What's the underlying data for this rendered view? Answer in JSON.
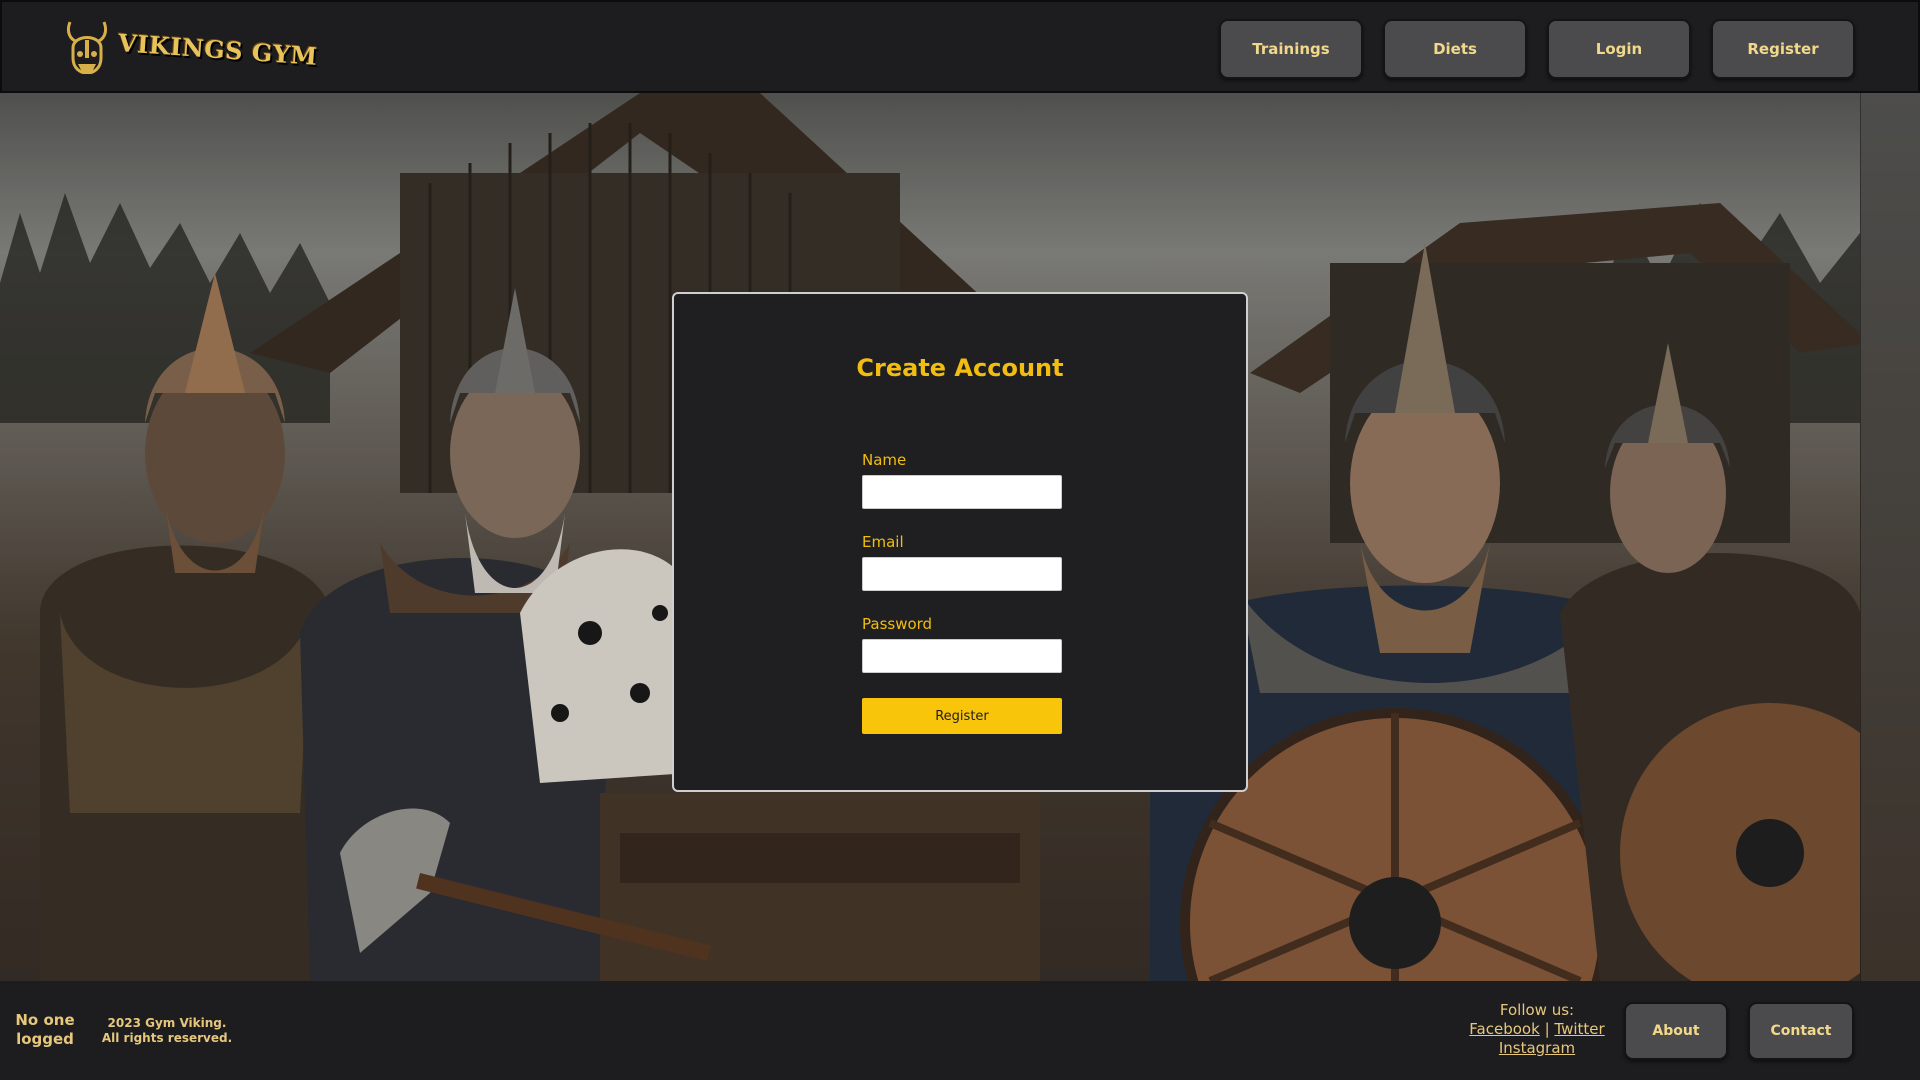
{
  "header": {
    "logo_text": "VIKINGS GYM",
    "nav": {
      "trainings": "Trainings",
      "diets": "Diets",
      "login": "Login",
      "register": "Register"
    }
  },
  "form": {
    "title": "Create Account",
    "name_label": "Name",
    "name_value": "",
    "email_label": "Email",
    "email_value": "",
    "password_label": "Password",
    "password_value": "",
    "submit_label": "Register"
  },
  "footer": {
    "session_status": "No one logged",
    "copyright_line1": "2023 Gym Viking.",
    "copyright_line2": "All rights reserved.",
    "follow_label": "Follow us:",
    "facebook": "Facebook",
    "separator": "|",
    "twitter": "Twitter",
    "instagram": "Instagram",
    "about": "About",
    "contact": "Contact"
  },
  "colors": {
    "accent": "#f9c50b",
    "title": "#f2bd10",
    "background": "#1f1f22",
    "button": "#4b4b4e"
  },
  "icons": {
    "logo": "horned-helmet-icon"
  }
}
